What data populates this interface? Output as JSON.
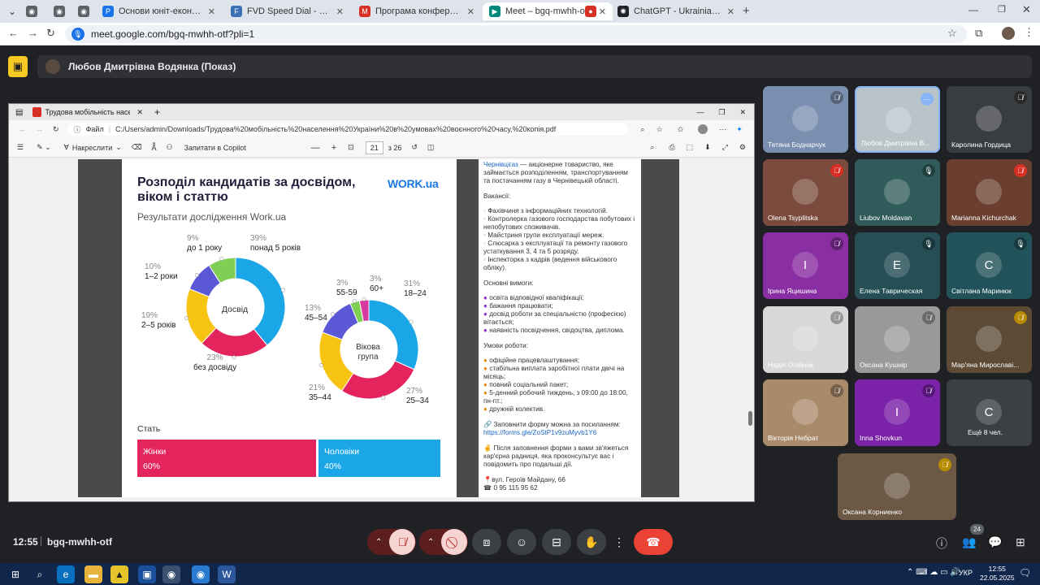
{
  "browser": {
    "tabs": [
      {
        "title": "",
        "icon": "globe-icon",
        "color": "#5f6368"
      },
      {
        "title": "",
        "icon": "globe-icon",
        "color": "#5f6368"
      },
      {
        "title": "",
        "icon": "globe-icon",
        "color": "#5f6368"
      },
      {
        "title": "Основи юніт-економіки. Форм",
        "icon": "p-icon",
        "color": "#1a73e8"
      },
      {
        "title": "FVD Speed Dial - Спонсирумен",
        "icon": "fvd-icon",
        "color": "#3b6fb6"
      },
      {
        "title": "Програма конференції_Кам'я",
        "icon": "gmail-icon",
        "color": "#d93025"
      },
      {
        "title": "Meet – bgq-mwhh-otf",
        "icon": "meet-icon",
        "color": "#00897b"
      },
      {
        "title": "",
        "icon": "record-icon",
        "color": "#d93025"
      },
      {
        "title": "ChatGPT - Ukrainian Voice",
        "icon": "chatgpt-icon",
        "color": "#202124"
      }
    ],
    "url": "meet.google.com/bgq-mwhh-otf?pli=1"
  },
  "meet": {
    "presenter": "Любов Дмитрівна Водянка (Показ)",
    "time": "12:55",
    "meeting_code": "bgq-mwhh-otf",
    "people_count": "24"
  },
  "pdf": {
    "tab_title": "Трудова мобільність населенн",
    "file_label": "Файл",
    "path": "C:/Users/admin/Downloads/Трудова%20мобільність%20населення%20України%20в%20умовах%20воєнного%20часу,%20копія.pdf",
    "draw_label": "Накреслити",
    "copilot_label": "Запитати в Copilot",
    "page_current": "21",
    "page_total": "з 26"
  },
  "slide": {
    "title_line1": "Розподіл кандидатів за досвідом,",
    "title_line2": "віком і статтю",
    "subtitle": "Результати дослідження Work.ua",
    "logo": "WORK.ua",
    "experience_center": "Досвід",
    "age_center_line1": "Вікова",
    "age_center_line2": "група",
    "gender_heading": "Стать",
    "women_label": "Жінки",
    "women_value": "60%",
    "men_label": "Чоловіки",
    "men_value": "40%"
  },
  "chart_data": [
    {
      "type": "pie",
      "title": "Досвід",
      "categories": [
        "понад 5 років",
        "без досвіду",
        "2–5 років",
        "1–2 роки",
        "до 1 року"
      ],
      "values": [
        39,
        23,
        19,
        10,
        9
      ],
      "pct_labels": [
        "39%",
        "23%",
        "19%",
        "10%",
        "9%"
      ],
      "colors": [
        "#1ba6e8",
        "#e3245d",
        "#f8c413",
        "#5b58d6",
        "#7fcf55"
      ]
    },
    {
      "type": "pie",
      "title": "Вікова група",
      "categories": [
        "18–24",
        "25–34",
        "35–44",
        "45–54",
        "55-59",
        "60+"
      ],
      "values": [
        31,
        27,
        21,
        13,
        3,
        3
      ],
      "pct_labels": [
        "31%",
        "27%",
        "21%",
        "13%",
        "3%",
        "3%"
      ],
      "colors": [
        "#1ba6e8",
        "#e3245d",
        "#f8c413",
        "#5b58d6",
        "#7fcf55",
        "#d63aa0"
      ]
    }
  ],
  "vacancy": {
    "company_link": "Чернівцігаз",
    "intro": " — акціонерне товариство, яке займається розподіленням, транспортуванням та постачанням газу в Чернівецькій області.",
    "vacancies_heading": "Вакансії:",
    "vacancies": [
      "Фахівчиня з інформаційних технологій.",
      "Контролерка газового господарства побутових і непобутових споживачів.",
      "Майстриня групи експлуатації мереж.",
      "Слюсарка з експлуатації та ремонту газового устаткування 3, 4 та 5 розряду.",
      "Інспекторка з кадрів (ведення військового обліку)."
    ],
    "requirements_heading": "Основні вимоги:",
    "requirements": [
      "освіта відповідної кваліфікації;",
      "бажання працювати;",
      "досвід роботи за спеціальністю (професією) вітається;",
      "наявність посвідчення, свідоцтва, диплома."
    ],
    "conditions_heading": "Умови роботи:",
    "conditions": [
      "офіційне працевлаштування;",
      "стабільна виплата заробітної плати двічі на місяць;",
      "повний соціальний пакет;",
      "5-денний робочий тиждень, з 09:00 до 18:00, пн-пт.;",
      "дружній колектив."
    ],
    "form_text": "Заповнити форму можна за посиланням:",
    "form_link": "https://forms.gle/ZoStP1v9zuMyvb1Y6",
    "after_text": "Після заповнення форми з вами зв'яжеться кар'єрна радниця, яка проконсультує вас і повідомить про подальші дії.",
    "address": "вул. Героїв Майдану, 66",
    "phone": "0 95 115 95 62"
  },
  "participants": [
    {
      "name": "Тетяна Боднарчук",
      "bg": "#7a8fb0",
      "avatar": "",
      "mic": "muted"
    },
    {
      "name": "Любов Дмитрівна В...",
      "bg": "#b9c4c9",
      "avatar": "",
      "mic": "more"
    },
    {
      "name": "Каролина Гордица",
      "bg": "#3a3d40",
      "avatar": "",
      "mic": "muted"
    },
    {
      "name": "Olena Tsyplitska",
      "bg": "#7b4c3d",
      "avatar": "",
      "mic": "muted-red"
    },
    {
      "name": "Liubov Moldavan",
      "bg": "#2f5c5a",
      "avatar": "",
      "mic": "speaking"
    },
    {
      "name": "Marianna Kichurchak",
      "bg": "#6b3f30",
      "avatar": "",
      "mic": "muted-red"
    },
    {
      "name": "Ірина Яцишина",
      "bg": "#8a2fa3",
      "avatar": "I",
      "mic": "muted"
    },
    {
      "name": "Елена Таврическая",
      "bg": "#254e55",
      "avatar": "E",
      "mic": "speaking"
    },
    {
      "name": "Світлана Маринюк",
      "bg": "#23535a",
      "avatar": "C",
      "mic": "speaking"
    },
    {
      "name": "Надія Олійник",
      "bg": "#d8d8d8",
      "avatar": "",
      "mic": "muted"
    },
    {
      "name": "Оксана Кушнір",
      "bg": "#9a9a9a",
      "avatar": "",
      "mic": "muted"
    },
    {
      "name": "Мар'яна Мирославі...",
      "bg": "#5c4a34",
      "avatar": "",
      "mic": "muted-yellow"
    },
    {
      "name": "Вікторія Небрат",
      "bg": "#a98a6a",
      "avatar": "",
      "mic": "muted"
    },
    {
      "name": "Inna Shovkun",
      "bg": "#7a22a8",
      "avatar": "I",
      "mic": "muted"
    },
    {
      "name": "Ещё 8 чел.",
      "bg": "#3c4043",
      "avatar": "C",
      "mic": ""
    },
    {
      "name": "Оксана Корниенко",
      "bg": "#6b5845",
      "avatar": "",
      "mic": "muted-yellow"
    }
  ],
  "taskbar": {
    "lang": "УКР",
    "time": "12:55",
    "date": "22.05.2025"
  }
}
